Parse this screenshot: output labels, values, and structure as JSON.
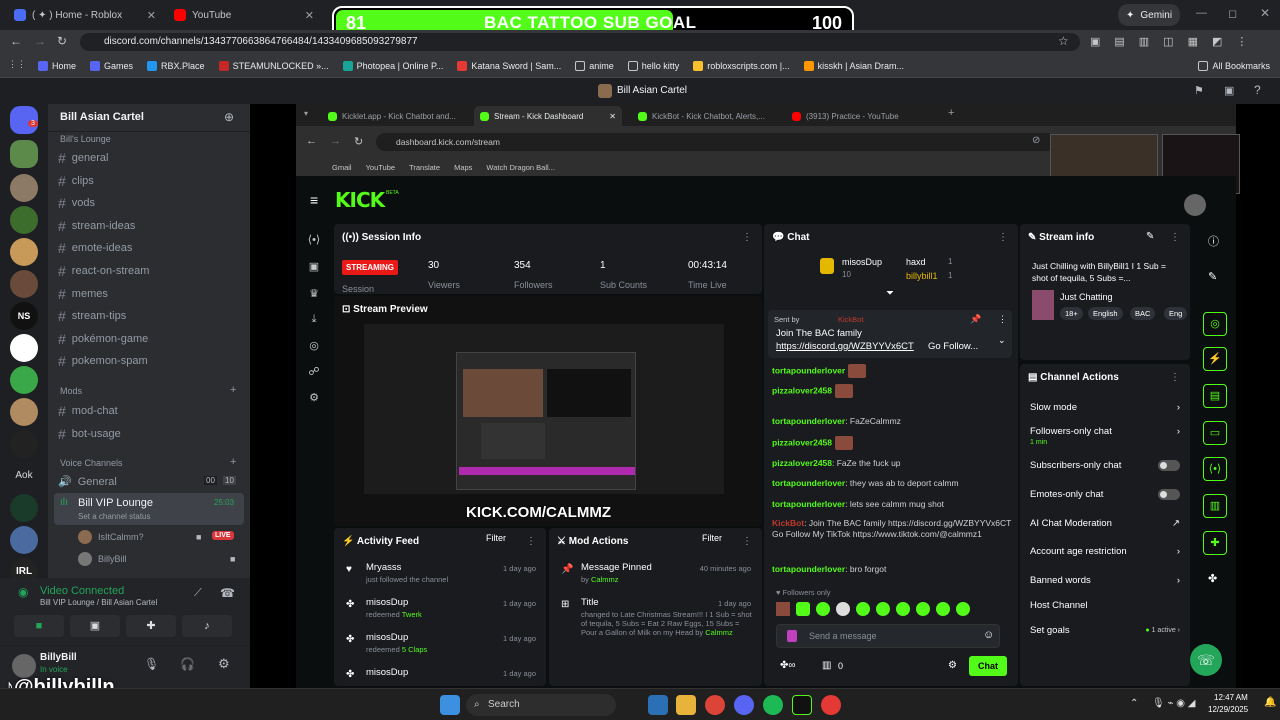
{
  "browser": {
    "tabs": [
      {
        "label": "( ✦ ) Home - Roblox",
        "active": false
      },
      {
        "label": "YouTube",
        "active": false
      },
      {
        "label": "",
        "active": true
      }
    ],
    "gemini_label": "Gemini",
    "url": "discord.com/channels/1343770663864766484/1433409685093279877",
    "bookmarks": [
      "Home",
      "Games",
      "RBX.Place",
      "STEAMUNLOCKED »...",
      "Photopea | Online P...",
      "Katana Sword | Sam...",
      "anime",
      "hello kitty",
      "robloxscripts.com |...",
      "kisskh | Asian Dram..."
    ],
    "all_bookmarks": "All Bookmarks"
  },
  "goal": {
    "current": "81",
    "title": "BAC TATTOO SUB GOAL",
    "target": "100",
    "progress_fraction": 0.81
  },
  "discord": {
    "window_title": "Bill Asian Cartel",
    "server_name": "Bill Asian Cartel",
    "categories": {
      "lounge": "Bill's Lounge",
      "mods": "Mods",
      "voice": "Voice Channels"
    },
    "channels": [
      "general",
      "clips",
      "vods",
      "stream-ideas",
      "emote-ideas",
      "react-on-stream",
      "memes",
      "stream-tips",
      "pokémon-game",
      "pokemon-spam"
    ],
    "mod_channels": [
      "mod-chat",
      "bot-usage"
    ],
    "voice_channels": {
      "general": "General",
      "general_count": "00",
      "general_limit": "10",
      "vip": "Bill VIP Lounge",
      "vip_time": "25:03",
      "vip_status": "Set a channel status",
      "members": [
        {
          "name": "IsItCalmm?",
          "badge": "LIVE"
        },
        {
          "name": "BillyBill",
          "badge": ""
        }
      ]
    },
    "voice_status": "Video Connected",
    "voice_location": "Bill VIP Lounge / Bill Asian Cartel",
    "user": {
      "name": "BillyBill",
      "status": "In voice"
    },
    "server_badge": "3"
  },
  "overlay_handle": "@billybilln",
  "inner_browser": {
    "tabs": [
      "Kicklet.app - Kick Chatbot and...",
      "Stream - Kick Dashboard",
      "KickBot - Kick Chatbot, Alerts,...",
      "(3913) Practice - YouTube"
    ],
    "url": "dashboard.kick.com/stream",
    "bookmarks": [
      "Gmail",
      "YouTube",
      "Translate",
      "Maps",
      "Watch Dragon Ball..."
    ]
  },
  "kick": {
    "logo": "KICK",
    "logo_tag": "BETA",
    "session": {
      "title": "Session Info",
      "status": "STREAMING",
      "viewers": "30",
      "viewers_label": "Viewers",
      "followers": "354",
      "followers_label": "Followers",
      "subs": "1",
      "subs_label": "Sub Counts",
      "time": "00:43:14",
      "time_label": "Time Live",
      "session_label": "Session"
    },
    "preview": {
      "title": "Stream Preview",
      "watermark": "KICK.COM/CALMMZ"
    },
    "activity": {
      "title": "Activity Feed",
      "filter": "Filter",
      "items": [
        {
          "name": "Mryasss",
          "sub": "just followed the channel",
          "time": "1 day ago"
        },
        {
          "name": "misosDup",
          "sub": "redeemed ",
          "reward": "Twerk",
          "time": "1 day ago"
        },
        {
          "name": "misosDup",
          "sub": "redeemed ",
          "reward": "5 Claps",
          "time": "1 day ago"
        },
        {
          "name": "misosDup",
          "sub": "",
          "time": "1 day ago"
        }
      ]
    },
    "mod_actions": {
      "title": "Mod Actions",
      "filter": "Filter",
      "items": [
        {
          "name": "Message Pinned",
          "by": "by ",
          "user": "Calmmz",
          "time": "40 minutes ago"
        },
        {
          "name": "Title",
          "detail": "changed to Late Christmas Stream!!! I 1 Sub = shot of tequila, 5 Subs = Eat 2 Raw Eggs, 15 Subs = Pour a Gallon of Milk on my Head by ",
          "user": "Calmmz",
          "time": "1 day ago"
        }
      ]
    },
    "chat": {
      "title": "Chat",
      "top": [
        {
          "name": "misosDup",
          "count": "10"
        },
        {
          "name": "haxd",
          "count": "1"
        },
        {
          "name": "billybill1",
          "count": "1"
        }
      ],
      "pinned": {
        "sent_by": "Sent by",
        "user": "KickBot",
        "text": "Join The BAC family",
        "link": "https://discord.gg/WZBYYVx6CT",
        "suffix": " Go Follow..."
      },
      "messages": [
        {
          "user": "tortapounderlover",
          "text": "",
          "emote": true,
          "red": false
        },
        {
          "user": "pizzalover2458",
          "text": "",
          "emote": true,
          "red": false
        },
        {
          "user": "tortapounderlover",
          "text": ": FaZeCalmmz",
          "emote": false,
          "red": false
        },
        {
          "user": "pizzalover2458",
          "text": "",
          "emote": true,
          "red": false
        },
        {
          "user": "pizzalover2458",
          "text": ": FaZe the fuck up",
          "emote": false,
          "red": false
        },
        {
          "user": "tortapounderlover",
          "text": ": they was ab to deport calmm",
          "emote": false,
          "red": false
        },
        {
          "user": "tortapounderlover",
          "text": ": lets see calmm mug shot",
          "emote": false,
          "red": false
        },
        {
          "user": "KickBot",
          "text": ": Join The BAC family https://discord.gg/WZBYYVx6CT Go Follow My TikTok https://www.tiktok.com/@calmmz1",
          "emote": false,
          "red": true
        },
        {
          "user": "tortapounderlover",
          "text": ": bro forgot",
          "emote": false,
          "red": false
        }
      ],
      "followers_only": "Followers only",
      "placeholder": "Send a message",
      "points": "0",
      "send": "Chat"
    },
    "stream_info": {
      "title": "Stream info",
      "stream_title": "Just Chilling with BillyBill1 I 1 Sub = shot of tequila, 5 Subs =...",
      "category": "Just Chatting",
      "tags": [
        "18+",
        "English",
        "BAC",
        "Eng"
      ]
    },
    "channel_actions": {
      "title": "Channel Actions",
      "rows": [
        "Slow mode",
        "Followers-only chat",
        "Subscribers-only chat",
        "Emotes-only chat",
        "AI Chat Moderation",
        "Account age restriction",
        "Banned words",
        "Host Channel",
        "Set goals"
      ],
      "followers_sub": "1 min",
      "goals_active": "1 active"
    }
  },
  "taskbar": {
    "search": "Search",
    "time": "12:47 AM",
    "date": "12/29/2025"
  },
  "colors": {
    "kick_green": "#53fc18",
    "discord_dark": "#2b2d31",
    "live_red": "#da373c"
  }
}
